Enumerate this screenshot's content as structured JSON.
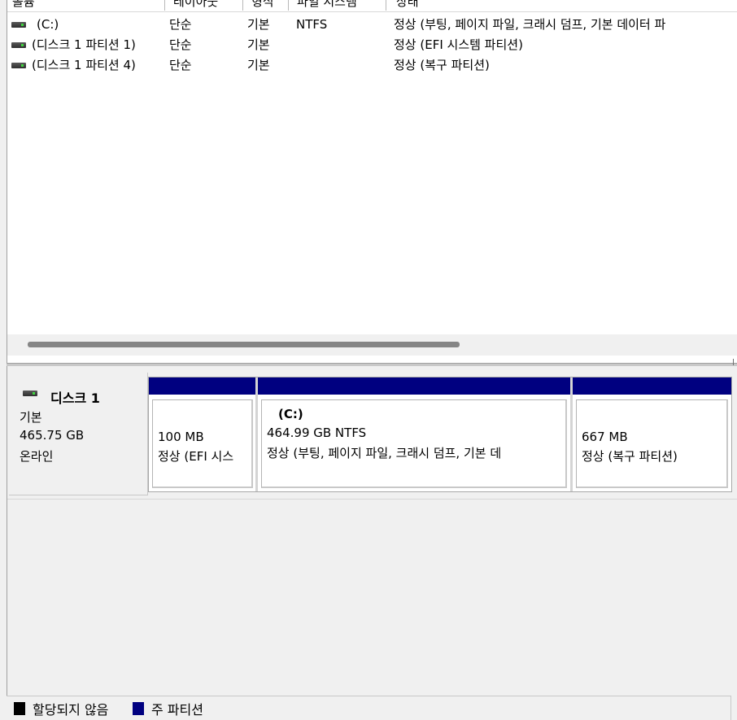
{
  "columns": [
    "볼륨",
    "레이아웃",
    "형식",
    "파일 시스템",
    "상태"
  ],
  "volumes": [
    {
      "name": "(C:)",
      "layout": "단순",
      "type": "기본",
      "fs": "NTFS",
      "status": "정상 (부팅, 페이지 파일, 크래시 덤프, 기본 데이터 파"
    },
    {
      "name": "(디스크 1 파티션 1)",
      "layout": "단순",
      "type": "기본",
      "fs": "",
      "status": "정상 (EFI 시스템 파티션)"
    },
    {
      "name": "(디스크 1 파티션 4)",
      "layout": "단순",
      "type": "기본",
      "fs": "",
      "status": "정상 (복구 파티션)"
    }
  ],
  "disk": {
    "name": "디스크 1",
    "kind": "기본",
    "size": "465.75 GB",
    "state": "온라인",
    "partitions": [
      {
        "label": "",
        "size": "100 MB",
        "status": "정상 (EFI 시스"
      },
      {
        "label": "(C:)",
        "size": "464.99 GB NTFS",
        "status": "정상 (부팅, 페이지 파일, 크래시 덤프, 기본 데"
      },
      {
        "label": "",
        "size": "667 MB",
        "status": "정상 (복구 파티션)"
      }
    ]
  },
  "legend": {
    "unallocated": "할당되지 않음",
    "primary": "주 파티션",
    "colors": {
      "unallocated": "#000000",
      "primary": "#000080"
    }
  },
  "icons": {
    "drive": "drive-icon"
  }
}
